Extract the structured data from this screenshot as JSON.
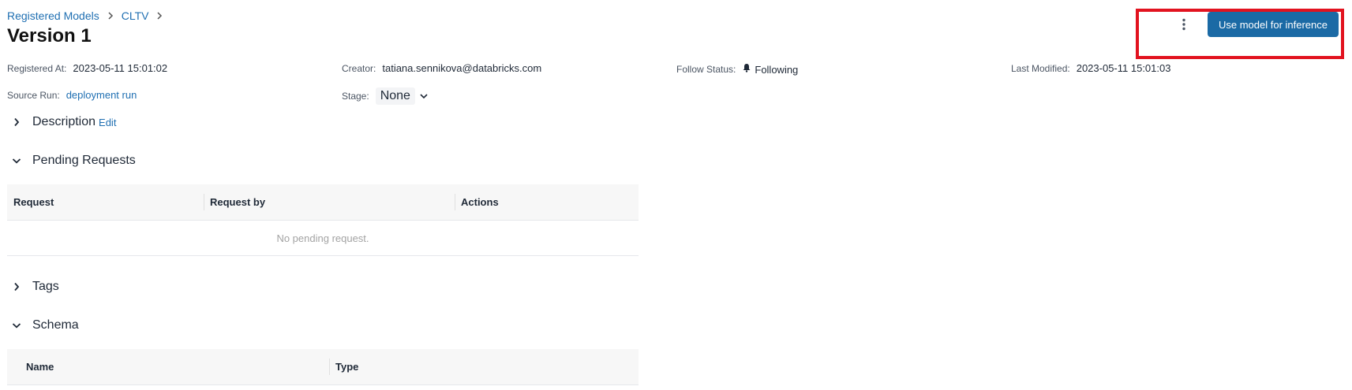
{
  "breadcrumb": {
    "items": [
      "Registered Models",
      "CLTV"
    ]
  },
  "page": {
    "title": "Version 1"
  },
  "header": {
    "inference_button": "Use model for inference",
    "more_icon": "vertical-dots-icon"
  },
  "meta": {
    "registered_at": {
      "label": "Registered At:",
      "value": "2023-05-11 15:01:02"
    },
    "creator": {
      "label": "Creator:",
      "value": "tatiana.sennikova@databricks.com"
    },
    "follow_status": {
      "label": "Follow Status:",
      "value": "Following"
    },
    "last_modified": {
      "label": "Last Modified:",
      "value": "2023-05-11 15:01:03"
    },
    "source_run": {
      "label": "Source Run:",
      "value": "deployment run"
    },
    "stage": {
      "label": "Stage:",
      "value": "None"
    }
  },
  "sections": {
    "description": {
      "title": "Description",
      "edit": "Edit"
    },
    "pending_requests": {
      "title": "Pending Requests",
      "columns": [
        "Request",
        "Request by",
        "Actions"
      ],
      "empty": "No pending request."
    },
    "tags": {
      "title": "Tags"
    },
    "schema": {
      "title": "Schema",
      "columns": [
        "Name",
        "Type"
      ]
    }
  },
  "colors": {
    "accent": "#1b6aa5",
    "link": "#1f6fb2",
    "highlight": "#e2131f"
  }
}
